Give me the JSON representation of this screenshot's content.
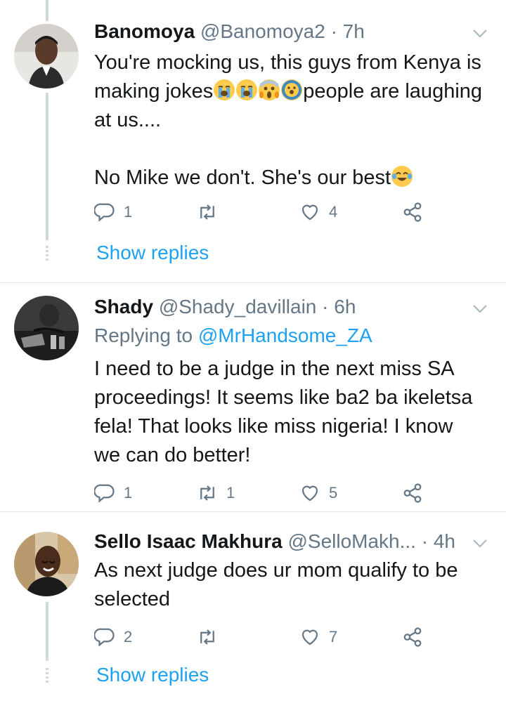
{
  "tweets": [
    {
      "name": "Banomoya",
      "handle": "@Banomoya2",
      "time": "· 7h",
      "replying_prefix": "",
      "replying_to": "",
      "text_before": "You're mocking us, this guys from Kenya is making jokes",
      "text_after": "people are laughing at us....\n\nNo Mike we don't. She's our best",
      "emoji_names": [
        "loudly-crying-face",
        "loudly-crying-face",
        "screaming-face",
        "face-with-hands",
        "face-with-tears-of-joy"
      ],
      "replies": "1",
      "retweets": "",
      "likes": "4",
      "show_replies": "Show replies"
    },
    {
      "name": "Shady",
      "handle": "@Shady_davillain",
      "time": "· 6h",
      "replying_prefix": "Replying to",
      "replying_to": "@MrHandsome_ZA",
      "text": "I need to be a judge in the next miss SA proceedings! It seems like ba2 ba ikeletsa fela!  That looks like miss nigeria! I know we can do better!",
      "replies": "1",
      "retweets": "1",
      "likes": "5"
    },
    {
      "name": "Sello Isaac Makhura",
      "handle": "@SelloMakh...",
      "time": "· 4h",
      "text": "As next judge does ur mom qualify to be selected",
      "replies": "2",
      "retweets": "",
      "likes": "7",
      "show_replies": "Show replies"
    }
  ],
  "icons": {
    "reply": "reply-icon",
    "retweet": "retweet-icon",
    "like": "heart-icon",
    "share": "share-icon",
    "more": "chevron-down-icon"
  },
  "colors": {
    "accent": "#1da1f2",
    "secondary_text": "#657786",
    "thread_line": "#cfd9de"
  }
}
